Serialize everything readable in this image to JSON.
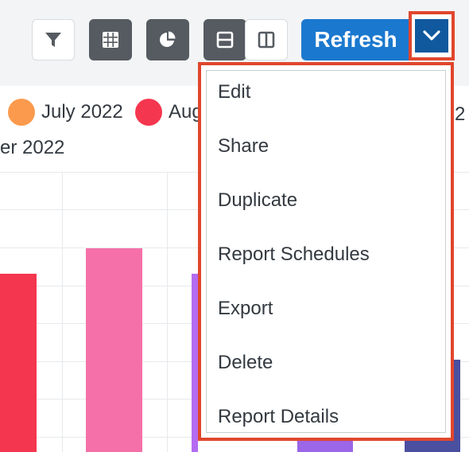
{
  "toolbar": {
    "buttons": [
      {
        "name": "filter",
        "icon": "filter-icon"
      },
      {
        "name": "table-view",
        "icon": "grid-icon"
      },
      {
        "name": "chart-view",
        "icon": "pie-chart-icon"
      },
      {
        "name": "horizontal-layout",
        "icon": "rows-layout-icon"
      },
      {
        "name": "vertical-layout",
        "icon": "columns-layout-icon"
      }
    ],
    "refresh_label": "Refresh",
    "actions_icon": "chevron-down-icon"
  },
  "legend": {
    "items": [
      {
        "label": "July 2022",
        "color": "#fb9a4c"
      },
      {
        "label": "Aug",
        "color": "#f5364f"
      },
      {
        "label": "2",
        "color": ""
      },
      {
        "label": "er 2022",
        "color": ""
      }
    ]
  },
  "colors": {
    "accent": "#1a78cf",
    "accent_dark": "#10599e",
    "highlight": "#e0462c",
    "bar_red": "#f5364f",
    "bar_pink": "#f570a8",
    "bar_purple": "#b46bf1",
    "bar_violet": "#9b66e8",
    "bar_navy": "#4a4fa0"
  },
  "menu": {
    "items": [
      {
        "label": "Edit"
      },
      {
        "label": "Share"
      },
      {
        "label": "Duplicate"
      },
      {
        "label": "Report Schedules"
      },
      {
        "label": "Export"
      },
      {
        "label": "Delete"
      },
      {
        "label": "Report Details"
      }
    ]
  }
}
